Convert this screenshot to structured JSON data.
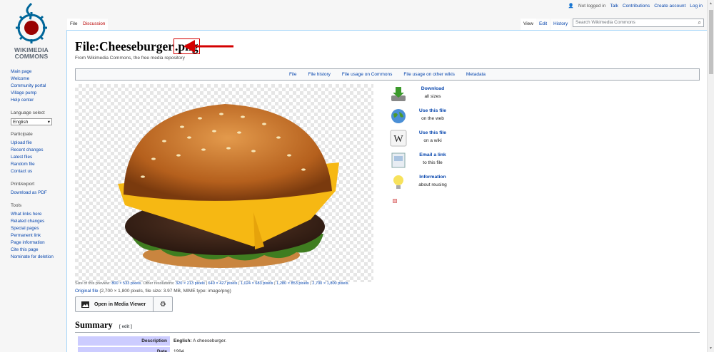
{
  "logo": {
    "line1": "WIKIMEDIA",
    "line2": "COMMONS"
  },
  "sidebar": {
    "nav": [
      "Main page",
      "Welcome",
      "Community portal",
      "Village pump",
      "Help center"
    ],
    "language": {
      "heading": "Language select",
      "selected": "English"
    },
    "participate": {
      "heading": "Participate",
      "items": [
        "Upload file",
        "Recent changes",
        "Latest files",
        "Random file",
        "Contact us"
      ]
    },
    "print": {
      "heading": "Print/export",
      "items": [
        "Download as PDF"
      ]
    },
    "tools": {
      "heading": "Tools",
      "items": [
        "What links here",
        "Related changes",
        "Special pages",
        "Permanent link",
        "Page information",
        "Cite this page",
        "Nominate for deletion"
      ]
    }
  },
  "personal": {
    "not_logged_in": "Not logged in",
    "talk": "Talk",
    "contributions": "Contributions",
    "create_account": "Create account",
    "log_in": "Log in"
  },
  "tabs": {
    "file": "File",
    "discussion": "Discussion",
    "view": "View",
    "edit": "Edit",
    "history": "History"
  },
  "search": {
    "placeholder": "Search Wikimedia Commons"
  },
  "page": {
    "title_base": "File:Cheeseburger",
    "title_ext": ".png",
    "subtitle": "From Wikimedia Commons, the free media repository"
  },
  "filetoc": [
    "File",
    "File history",
    "File usage on Commons",
    "File usage on other wikis",
    "Metadata"
  ],
  "actions": [
    {
      "title": "Download",
      "sub": "all sizes",
      "icon": "download-icon"
    },
    {
      "title": "Use this file",
      "sub": "on the web",
      "icon": "globe-icon"
    },
    {
      "title": "Use this file",
      "sub": "on a wiki",
      "icon": "wiki-icon"
    },
    {
      "title": "Email a link",
      "sub": "to this file",
      "icon": "email-icon"
    },
    {
      "title": "Information",
      "sub": "about reusing",
      "icon": "lightbulb-icon"
    }
  ],
  "resolutions": {
    "preview_label": "Size of this preview:",
    "preview_size": "800 × 533 pixels",
    "other_label": ". Other resolutions:",
    "r1": "320 × 213 pixels",
    "r2": "640 × 427 pixels",
    "r3": "1,024 × 683 pixels",
    "r4": "1,280 × 853 pixels",
    "r5": "2,700 × 1,800 pixels",
    "sep": "|"
  },
  "original": {
    "link": "Original file",
    "details": "(2,700 × 1,800 pixels, file size: 3.97 MB, MIME type: image/png)"
  },
  "media_viewer": {
    "label": "Open in Media Viewer"
  },
  "summary": {
    "heading": "Summary",
    "edit": "[ edit ]",
    "rows": [
      {
        "key": "Description",
        "lang": "English:",
        "value": "A cheeseburger."
      },
      {
        "key": "Date",
        "lang": "",
        "value": "1994"
      }
    ]
  },
  "colors": {
    "link": "#0645ad",
    "arrow": "#d40000",
    "highlight_box": "#d40000"
  }
}
